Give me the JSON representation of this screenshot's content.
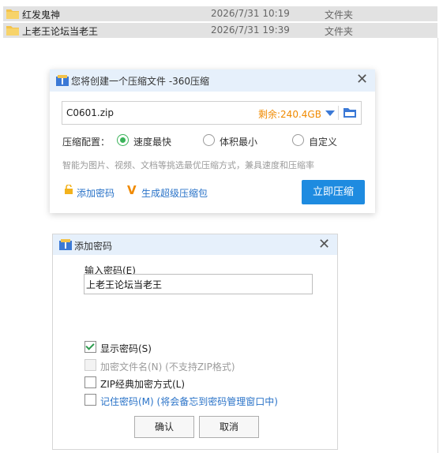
{
  "file_list": [
    {
      "name": "红发鬼神",
      "date": "2026/7/31 10:19",
      "type": "文件夹"
    },
    {
      "name": "上老王论坛当老王",
      "date": "2026/7/31 19:39",
      "type": "文件夹"
    }
  ],
  "compress_dialog": {
    "title": "您将创建一个压缩文件 -360压缩",
    "filename": "C0601.zip",
    "free_space": "剩余:240.4GB",
    "config_label": "压缩配置：",
    "options": [
      "速度最快",
      "体积最小",
      "自定义"
    ],
    "selected_option": "速度最快",
    "hint": "智能为图片、视频、文档等挑选最优压缩方式，兼具速度和压缩率",
    "add_password": "添加密码",
    "super_zip": "生成超级压缩包",
    "compress_button": "立即压缩"
  },
  "password_dialog": {
    "title": "添加密码",
    "input_label": "输入密码(E)",
    "password_value": "上老王论坛当老王",
    "checkboxes": [
      {
        "label": "显示密码(S)",
        "checked": true,
        "enabled": true
      },
      {
        "label": "加密文件名(N) (不支持ZIP格式)",
        "checked": false,
        "enabled": false
      },
      {
        "label": "ZIP经典加密方式(L)",
        "checked": false,
        "enabled": true
      },
      {
        "label": "记住密码(M) (将会备忘到密码管理窗口中)",
        "checked": false,
        "enabled": true
      }
    ],
    "ok_button": "确认",
    "cancel_button": "取消"
  },
  "colors": {
    "accent": "#1e8be0",
    "link": "#2a73c8",
    "orange": "#f08a00",
    "title_bar": "#e6f0fb"
  }
}
